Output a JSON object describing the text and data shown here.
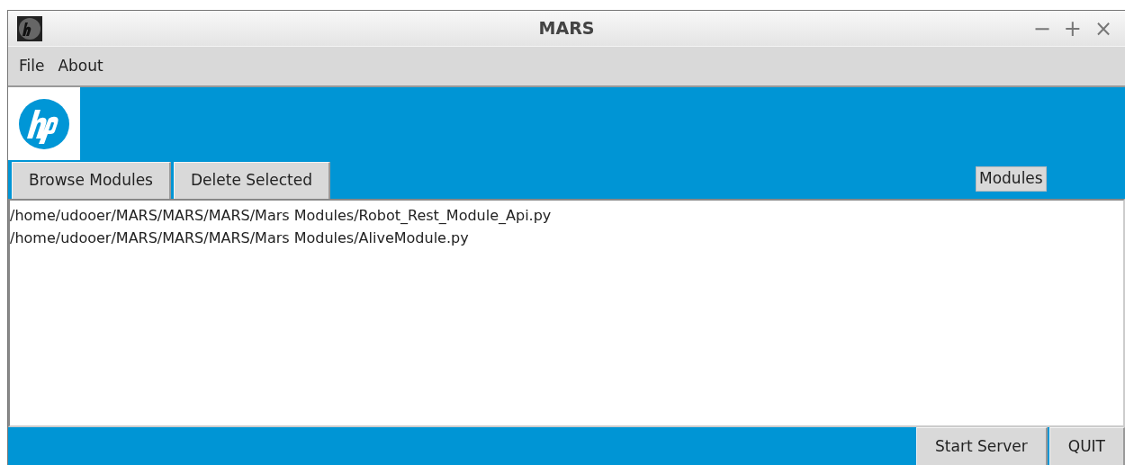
{
  "window": {
    "title": "MARS",
    "controls": [
      "−",
      "+",
      "×"
    ]
  },
  "menu": [
    "File",
    "About"
  ],
  "toolbar": {
    "buttons": [
      "Browse Modules",
      "Delete Selected"
    ],
    "label": "Modules"
  },
  "modules": [
    "/home/udooer/MARS/MARS/MARS/Mars Modules/Robot_Rest_Module_Api.py",
    "/home/udooer/MARS/MARS/MARS/Mars Modules/AliveModule.py"
  ],
  "footer": {
    "buttons": [
      "Start Server",
      "QUIT"
    ]
  }
}
